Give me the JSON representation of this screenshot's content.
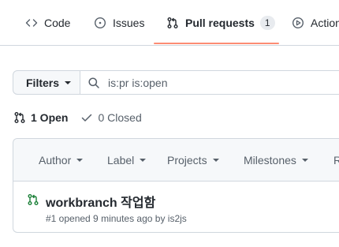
{
  "tabs": [
    {
      "label": "Code",
      "icon": "code-icon"
    },
    {
      "label": "Issues",
      "icon": "issue-opened-icon"
    },
    {
      "label": "Pull requests",
      "icon": "git-pull-request-icon",
      "count": "1",
      "selected": true
    },
    {
      "label": "Actions",
      "icon": "play-icon"
    }
  ],
  "filter_bar": {
    "filters_label": "Filters",
    "search_value": "is:pr is:open"
  },
  "states": {
    "open_label": "1 Open",
    "closed_label": "0 Closed"
  },
  "list_header": {
    "filters": [
      "Author",
      "Label",
      "Projects",
      "Milestones",
      "R"
    ]
  },
  "pull_requests": [
    {
      "title": "workbranch 작업함",
      "meta": "#1 opened 9 minutes ago by is2js",
      "status": "open"
    }
  ],
  "colors": {
    "accent_underline": "#fd8c73",
    "open_green": "#1a7f37",
    "border": "#d0d7de",
    "muted_text": "#57606a"
  }
}
